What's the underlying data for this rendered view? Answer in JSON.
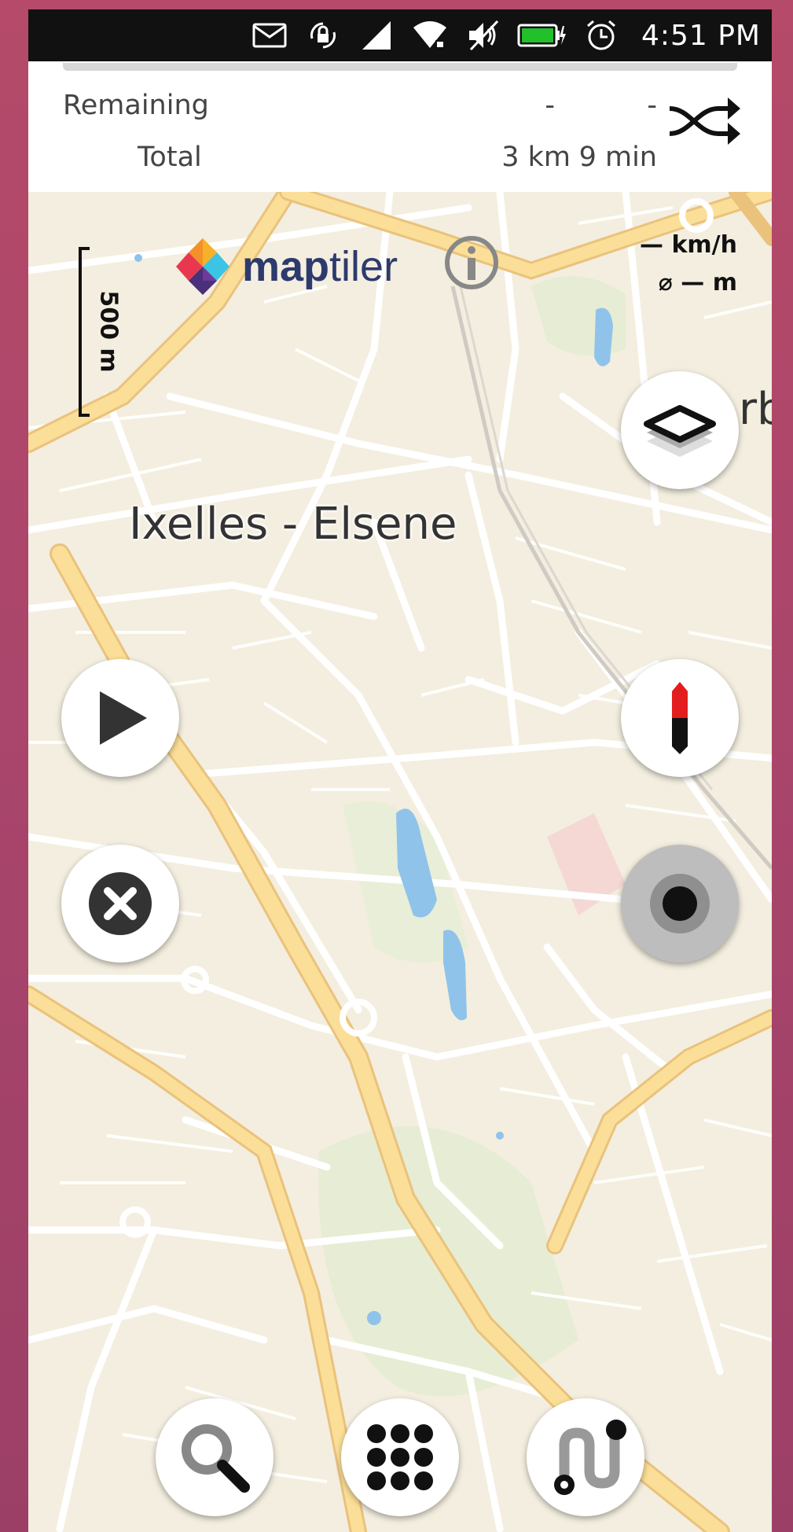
{
  "status_bar": {
    "time": "4:51 PM",
    "icons": [
      "mail-icon",
      "rotation-lock-icon",
      "cell-signal-icon",
      "wifi-lock-icon",
      "muted-icon",
      "battery-charging-icon",
      "alarm-icon"
    ]
  },
  "route_info": {
    "remaining_label": "Remaining",
    "remaining_distance": "-",
    "remaining_time": "-",
    "total_label": "Total",
    "total_distance": "3 km",
    "total_time": "9 min",
    "progress": 0
  },
  "map": {
    "scale_label": "500 m",
    "logo_map": "map",
    "logo_tiler": "tiler",
    "speed_text": "— km/h",
    "avg_text": "⌀ — m",
    "place_name": "Ixelles - Elsene",
    "edge_label": "rb"
  },
  "colors": {
    "map_background": "#f3eedf",
    "major_road": "#fbdf98",
    "minor_road": "#ffffff",
    "water": "#8fc3ea",
    "park": "#e3ecd0",
    "compass_red": "#e31d1d"
  },
  "buttons": {
    "layers": "layers-icon",
    "play": "play-icon",
    "compass": "compass-icon",
    "clear": "close-icon",
    "locate": "locate-icon",
    "search": "search-icon",
    "menu": "grid-icon",
    "route": "route-icon"
  }
}
